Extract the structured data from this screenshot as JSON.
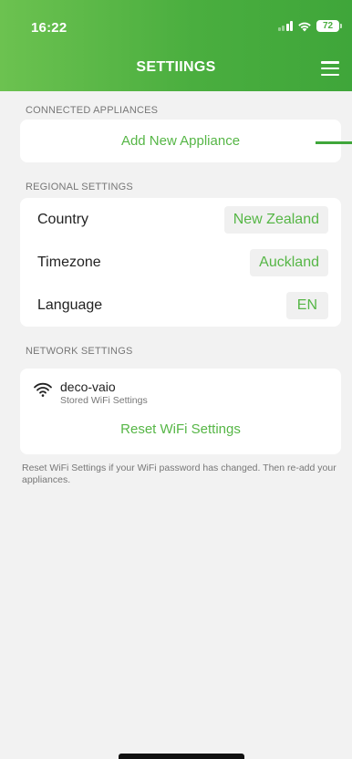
{
  "status_bar": {
    "time": "16:22",
    "battery_level": "72",
    "signal_bars": 4,
    "signal_bars_active": 2
  },
  "header": {
    "title": "SETTIINGS",
    "menu_icon": "hamburger-menu-icon",
    "background_color": "#4aae3f"
  },
  "connected_appliances": {
    "section_label": "CONNECTED APPLIANCES",
    "add_button_label": "Add New Appliance"
  },
  "regional_settings": {
    "section_label": "REGIONAL SETTINGS",
    "rows": [
      {
        "label": "Country",
        "value": "New Zealand"
      },
      {
        "label": "Timezone",
        "value": "Auckland"
      },
      {
        "label": "Language",
        "value": "EN"
      }
    ]
  },
  "network_settings": {
    "section_label": "NETWORK SETTINGS",
    "wifi_icon": "wifi-icon",
    "network_name": "deco-vaio",
    "network_subtitle": "Stored WiFi Settings",
    "reset_button_label": "Reset WiFi Settings",
    "note": "Reset WiFi Settings if your WiFi password has changed. Then re-add your appliances."
  },
  "colors": {
    "accent": "#56b646",
    "page_background": "#f2f2f2"
  }
}
